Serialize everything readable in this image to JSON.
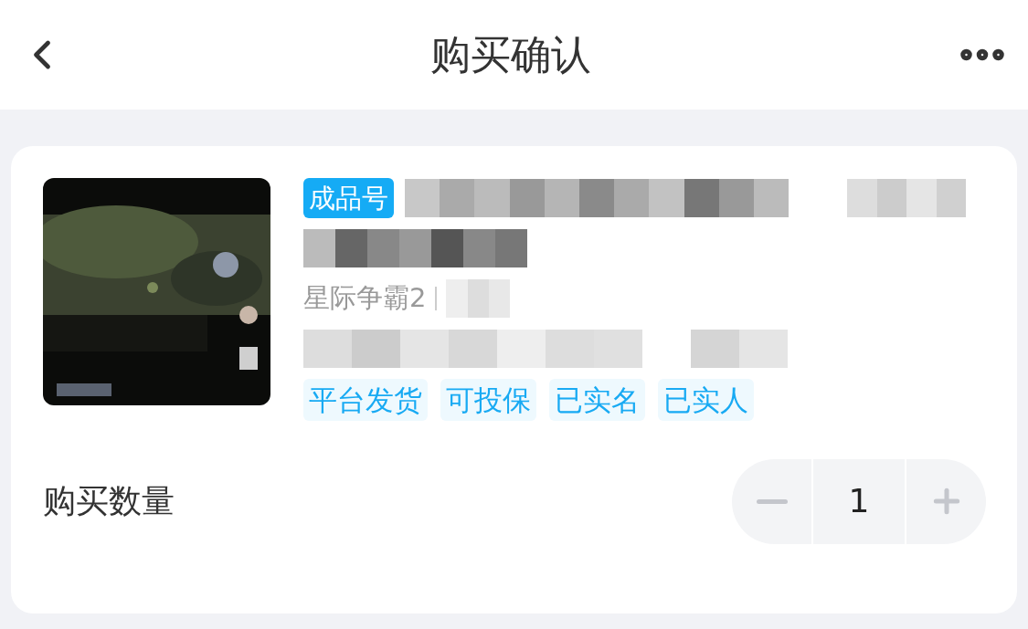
{
  "header": {
    "title": "购买确认"
  },
  "product": {
    "badge": "成品号",
    "game": "星际争霸2",
    "tags": [
      "平台发货",
      "可投保",
      "已实名",
      "已实人"
    ]
  },
  "quantity": {
    "label": "购买数量",
    "value": "1"
  }
}
